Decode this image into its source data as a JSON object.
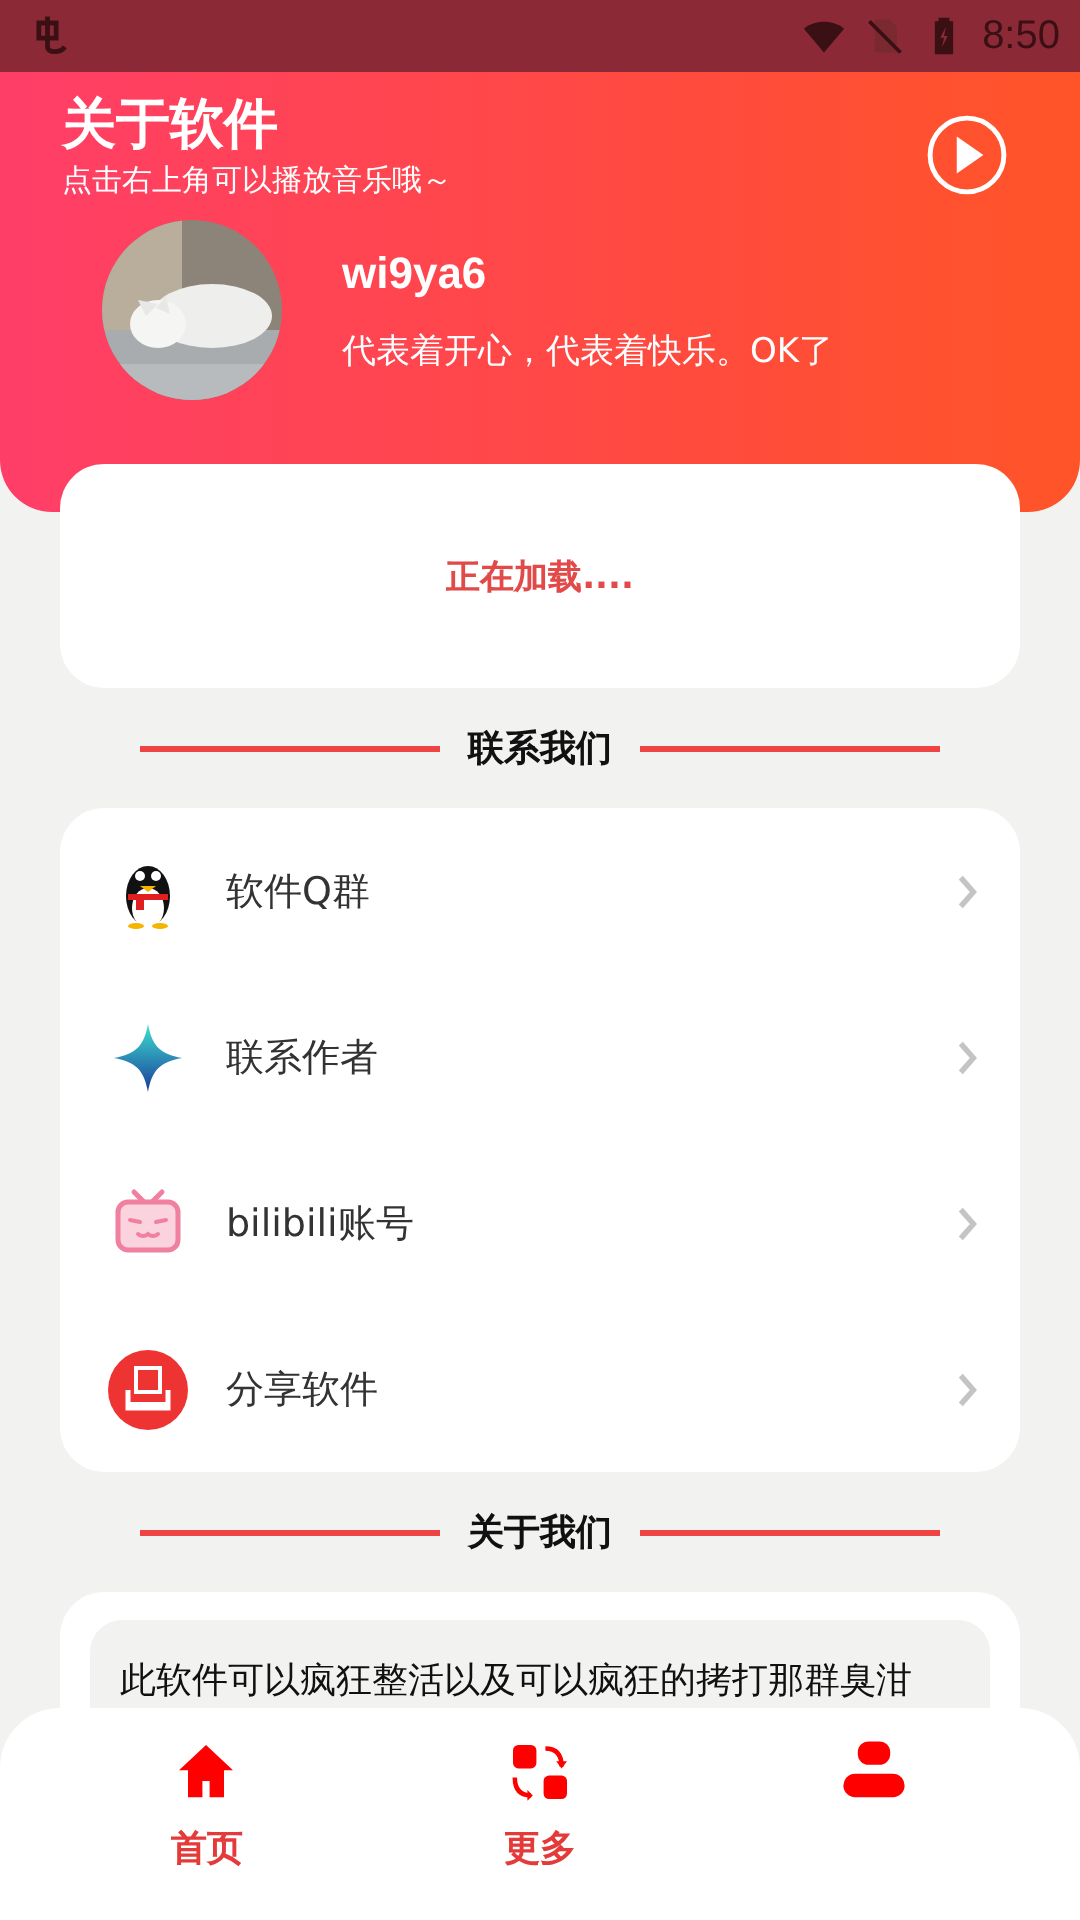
{
  "status_bar": {
    "time": "8:50"
  },
  "header": {
    "title": "关于软件",
    "subtitle": "点击右上角可以播放音乐哦～",
    "profile": {
      "name": "wi9ya6",
      "motto": "代表着开心，代表着快乐。OK了"
    }
  },
  "loading": {
    "text": "正在加载...."
  },
  "contact": {
    "heading": "联系我们",
    "items": [
      {
        "kind": "qq",
        "label": "软件Q群"
      },
      {
        "kind": "star",
        "label": "联系作者"
      },
      {
        "kind": "tv",
        "label": "bilibili账号"
      },
      {
        "kind": "share",
        "label": "分享软件"
      }
    ]
  },
  "about": {
    "heading": "关于我们",
    "text": "此软件可以疯狂整活以及可以疯狂的拷打那群臭泔"
  },
  "nav": [
    {
      "kind": "home",
      "label": "首页"
    },
    {
      "kind": "more",
      "label": "更多"
    },
    {
      "kind": "user"
    }
  ]
}
